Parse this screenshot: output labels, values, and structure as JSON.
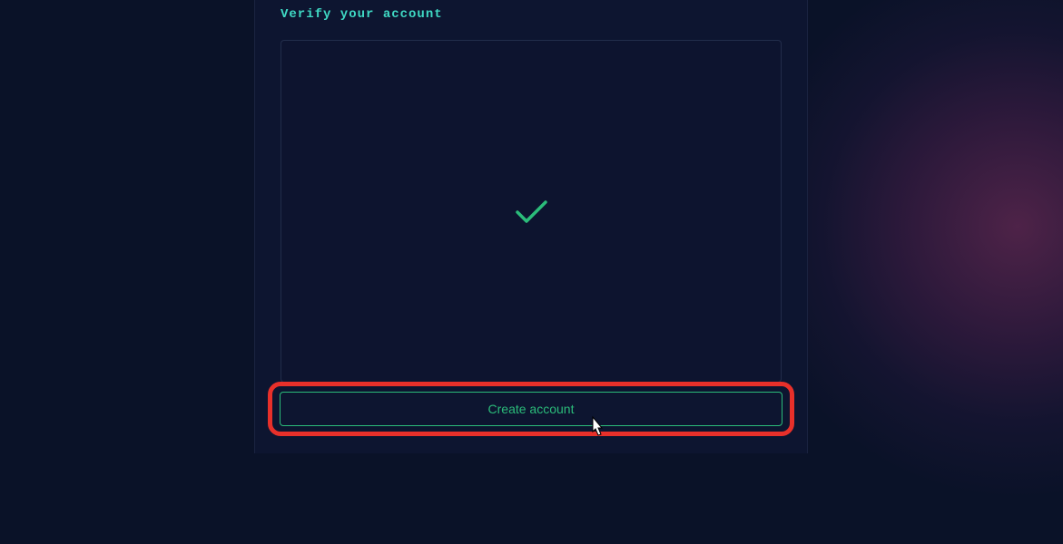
{
  "heading": "Verify your account",
  "button": {
    "create_label": "Create account"
  }
}
